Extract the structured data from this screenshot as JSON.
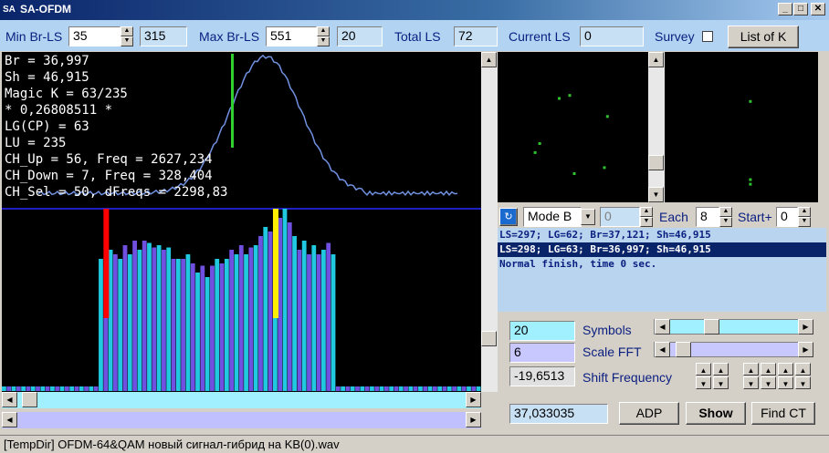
{
  "window": {
    "title": "SA-OFDM",
    "icon_text": "SA",
    "controls": [
      "_",
      "□",
      "✕"
    ]
  },
  "toolbar": {
    "min_br_ls_label": "Min Br-LS",
    "min_br_ls_value": "35",
    "min_br_ls_aux": "315",
    "max_br_ls_label": "Max Br-LS",
    "max_br_ls_value": "551",
    "max_br_ls_aux": "20",
    "total_ls_label": "Total LS",
    "total_ls_value": "72",
    "current_ls_label": "Current LS",
    "current_ls_value": "0",
    "survey_label": "Survey",
    "list_of_k_label": "List of K"
  },
  "terminal": {
    "lines": [
      "Br = 36,997",
      "Sh = 46,915",
      "Magic K = 63/235",
      "* 0,26808511 *",
      "LG(CP) = 63",
      "LU = 235",
      "CH_Up = 56, Freq = 2627,234",
      "CH_Down = 7, Freq = 328,404",
      "CH_Sel = 50, dFreqs = 2298,83"
    ]
  },
  "curve": {
    "peak_fraction_x": 0.55,
    "green_marker_fraction_x": 0.3
  },
  "spectrum": {
    "bar_values": [
      2,
      2,
      2,
      2,
      2,
      2,
      2,
      2,
      2,
      2,
      2,
      2,
      2,
      2,
      2,
      2,
      2,
      2,
      2,
      2,
      58,
      55,
      62,
      60,
      58,
      64,
      60,
      66,
      62,
      66,
      65,
      63,
      64,
      62,
      63,
      58,
      58,
      58,
      60,
      56,
      52,
      55,
      50,
      55,
      58,
      56,
      58,
      62,
      60,
      64,
      60,
      63,
      64,
      68,
      72,
      70,
      72,
      76,
      80,
      74,
      68,
      62,
      66,
      60,
      64,
      60,
      62,
      65,
      60,
      2,
      2,
      2,
      2,
      2,
      2,
      2,
      2,
      2,
      2,
      2,
      2,
      2,
      2,
      2,
      2,
      2,
      2,
      2,
      2,
      2,
      2,
      2,
      2,
      2,
      2,
      2,
      2,
      2,
      2
    ],
    "red_marker_index": 20,
    "yellow_marker_index": 55
  },
  "constellation": {
    "left_points": [
      [
        0.4,
        0.3
      ],
      [
        0.47,
        0.28
      ],
      [
        0.72,
        0.42
      ],
      [
        0.27,
        0.6
      ],
      [
        0.24,
        0.66
      ],
      [
        0.5,
        0.8
      ],
      [
        0.7,
        0.76
      ]
    ],
    "right_points": [
      [
        0.55,
        0.32
      ],
      [
        0.55,
        0.84
      ],
      [
        0.55,
        0.87
      ]
    ]
  },
  "mode_row": {
    "mode_value": "Mode B",
    "num_value": "0",
    "each_label": "Each",
    "each_value": "8",
    "start_label": "Start+",
    "start_value": "0"
  },
  "log": {
    "lines": [
      "LS=297; LG=62; Br=37,121; Sh=46,915",
      "LS=298; LG=63; Br=36,997; Sh=46,915",
      "Normal finish, time 0 sec."
    ],
    "selected_index": 1
  },
  "controls": {
    "symbols_value": "20",
    "symbols_label": "Symbols",
    "scale_fft_value": "6",
    "scale_fft_label": "Scale FFT",
    "shift_freq_value": "-19,6513",
    "shift_freq_label": "Shift Frequency",
    "result_value": "37,033035",
    "adp_label": "ADP",
    "show_label": "Show",
    "find_ct_label": "Find CT",
    "symbols_slider_pos": 0.3,
    "scale_slider_pos": 0.05
  },
  "statusbar": {
    "text": "[TempDir] OFDM-64&QAM новый сигнал-гибрид на KB(0).wav"
  },
  "colors": {
    "bar_primary": "#20c8e0",
    "bar_secondary": "#7050e0",
    "curve": "#7090e0",
    "marker_green": "#30d030",
    "marker_red": "#ff0000",
    "marker_yellow": "#ffee00",
    "constellation_dot": "#30c030"
  }
}
